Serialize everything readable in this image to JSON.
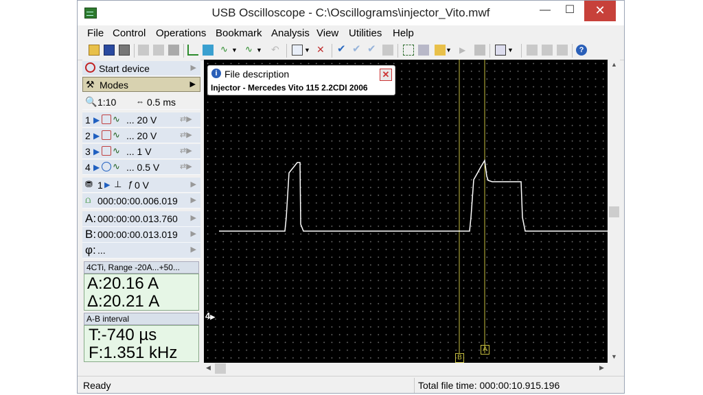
{
  "window": {
    "title": "USB Oscilloscope - C:\\Oscillograms\\injector_Vito.mwf",
    "minimize": "—",
    "maximize": "☐",
    "close": "✕"
  },
  "menu": [
    "File",
    "Control",
    "Operations",
    "Bookmark",
    "Analysis",
    "View",
    "Utilities",
    "Help"
  ],
  "left_panel": {
    "start_device": "Start device",
    "modes": "Modes",
    "zoom": "1:10",
    "timebase": "0.5 ms",
    "channels": [
      {
        "num": "1",
        "range": "... 20 V"
      },
      {
        "num": "2",
        "range": "... 20 V"
      },
      {
        "num": "3",
        "range": "... 1 V"
      },
      {
        "num": "4",
        "range": "... 0.5 V"
      }
    ],
    "trigger_channel": "1",
    "trigger_level": "0 V",
    "trigger_time": "000:00:00.006.019",
    "cursor_a": "000:00:00.013.760",
    "cursor_b": "000:00:00.013.019",
    "phi": "...",
    "a_label": "A:",
    "b_label": "B:",
    "phi_label": "φ:",
    "ch4_header": "4CTi, Range -20A...+50...",
    "a_value": "A:20.16 A",
    "delta_value": "Δ:20.21 A",
    "ab_header": "A-B interval",
    "t_value": "T:-740 µs",
    "f_value": "F:1.351 kHz"
  },
  "file_description": {
    "header": "File description",
    "text": "Injector - Mercedes Vito 115 2.2CDI 2006"
  },
  "scope": {
    "channel_marker": "4",
    "cursor_a_label": "A",
    "cursor_b_label": "B",
    "trace_color": "#ffffff",
    "cursor_color": "#c8c040"
  },
  "status": {
    "left": "Ready",
    "right": "Total file time: 000:00:10.915.196"
  }
}
